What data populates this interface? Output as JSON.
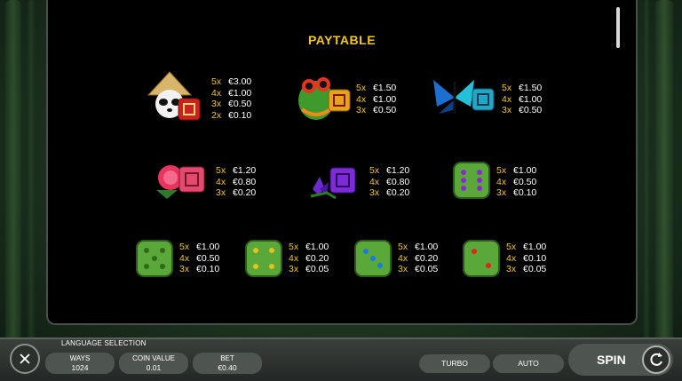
{
  "paytable": {
    "title": "PAYTABLE",
    "symbols": [
      {
        "name": "panda",
        "pays": [
          {
            "m": "5x",
            "v": "€3.00"
          },
          {
            "m": "4x",
            "v": "€1.00"
          },
          {
            "m": "3x",
            "v": "€0.50"
          },
          {
            "m": "2x",
            "v": "€0.10"
          }
        ]
      },
      {
        "name": "frog",
        "pays": [
          {
            "m": "5x",
            "v": "€1.50"
          },
          {
            "m": "4x",
            "v": "€1.00"
          },
          {
            "m": "3x",
            "v": "€0.50"
          }
        ]
      },
      {
        "name": "butterfly",
        "pays": [
          {
            "m": "5x",
            "v": "€1.50"
          },
          {
            "m": "4x",
            "v": "€1.00"
          },
          {
            "m": "3x",
            "v": "€0.50"
          }
        ]
      },
      {
        "name": "pink-flower",
        "pays": [
          {
            "m": "5x",
            "v": "€1.20"
          },
          {
            "m": "4x",
            "v": "€0.80"
          },
          {
            "m": "3x",
            "v": "€0.20"
          }
        ]
      },
      {
        "name": "purple-flower",
        "pays": [
          {
            "m": "5x",
            "v": "€1.20"
          },
          {
            "m": "4x",
            "v": "€0.80"
          },
          {
            "m": "3x",
            "v": "€0.20"
          }
        ]
      },
      {
        "name": "purple-dice",
        "pays": [
          {
            "m": "5x",
            "v": "€1.00"
          },
          {
            "m": "4x",
            "v": "€0.50"
          },
          {
            "m": "3x",
            "v": "€0.10"
          }
        ]
      },
      {
        "name": "green-dice",
        "pays": [
          {
            "m": "5x",
            "v": "€1.00"
          },
          {
            "m": "4x",
            "v": "€0.50"
          },
          {
            "m": "3x",
            "v": "€0.10"
          }
        ]
      },
      {
        "name": "yellow-dice",
        "pays": [
          {
            "m": "5x",
            "v": "€1.00"
          },
          {
            "m": "4x",
            "v": "€0.20"
          },
          {
            "m": "3x",
            "v": "€0.05"
          }
        ]
      },
      {
        "name": "blue-dice",
        "pays": [
          {
            "m": "5x",
            "v": "€1.00"
          },
          {
            "m": "4x",
            "v": "€0.20"
          },
          {
            "m": "3x",
            "v": "€0.05"
          }
        ]
      },
      {
        "name": "red-dice",
        "pays": [
          {
            "m": "5x",
            "v": "€1.00"
          },
          {
            "m": "4x",
            "v": "€0.10"
          },
          {
            "m": "3x",
            "v": "€0.05"
          }
        ]
      }
    ]
  },
  "bottom_bar": {
    "language_selection": "LANGUAGE SELECTION",
    "ways_label": "WAYS",
    "ways_value": "1024",
    "coin_value_label": "COIN VALUE",
    "coin_value": "0.01",
    "bet_label": "BET",
    "bet_value": "€0.40",
    "turbo_label": "TURBO",
    "auto_label": "AUTO",
    "spin_label": "SPIN"
  },
  "icons": [
    "close-icon",
    "autoplay-refresh-icon"
  ],
  "colors": {
    "accent": "#f5c51a",
    "panel": "#000000",
    "button": "#4e5551"
  }
}
